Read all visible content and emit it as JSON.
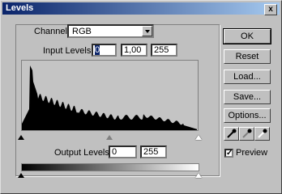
{
  "window": {
    "title": "Levels",
    "close_label": "x"
  },
  "channel": {
    "label": "Channel:",
    "value": "RGB"
  },
  "input_levels": {
    "label": "Input Levels:",
    "black": "0",
    "gamma": "1,00",
    "white": "255"
  },
  "output_levels": {
    "label": "Output Levels:",
    "black": "0",
    "white": "255"
  },
  "buttons": {
    "ok": "OK",
    "reset": "Reset",
    "load": "Load...",
    "save": "Save...",
    "options": "Options..."
  },
  "preview": {
    "label": "Preview",
    "checked": true,
    "mark": "✓"
  },
  "icons": {
    "eyedroppers": [
      "black-eyedropper-icon",
      "gray-eyedropper-icon",
      "white-eyedropper-icon"
    ]
  },
  "colors": {
    "title_bar": "#0a246a",
    "histogram": "#000000",
    "selection": "#0a246a"
  }
}
